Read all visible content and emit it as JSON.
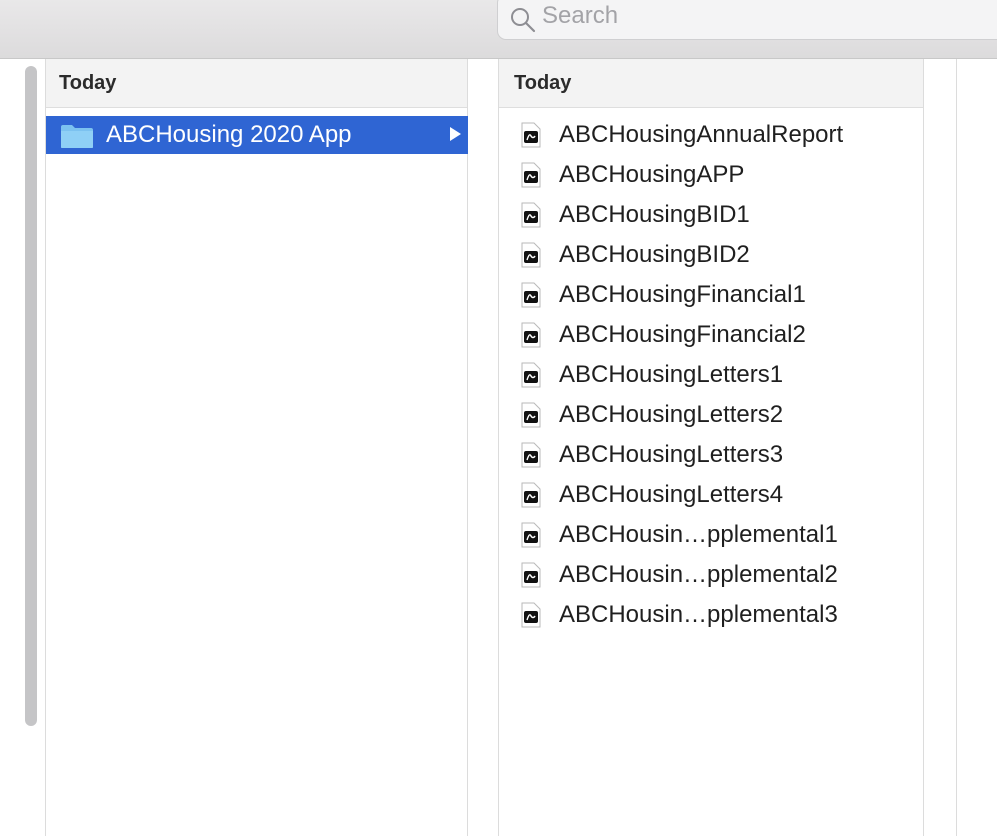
{
  "toolbar": {
    "search": {
      "placeholder": "Search",
      "value": ""
    }
  },
  "columns": [
    {
      "header": "Today",
      "items": [
        {
          "label": "ABCHousing 2020 App",
          "type": "folder",
          "selected": true,
          "icon": "folder-icon"
        }
      ]
    },
    {
      "header": "Today",
      "items": [
        {
          "label": "ABCHousingAnnualReport",
          "type": "pdf",
          "icon": "pdf-file-icon"
        },
        {
          "label": "ABCHousingAPP",
          "type": "pdf",
          "icon": "pdf-file-icon"
        },
        {
          "label": "ABCHousingBID1",
          "type": "pdf",
          "icon": "pdf-file-icon"
        },
        {
          "label": "ABCHousingBID2",
          "type": "pdf",
          "icon": "pdf-file-icon"
        },
        {
          "label": "ABCHousingFinancial1",
          "type": "pdf",
          "icon": "pdf-file-icon"
        },
        {
          "label": "ABCHousingFinancial2",
          "type": "pdf",
          "icon": "pdf-file-icon"
        },
        {
          "label": "ABCHousingLetters1",
          "type": "pdf",
          "icon": "pdf-file-icon"
        },
        {
          "label": "ABCHousingLetters2",
          "type": "pdf",
          "icon": "pdf-file-icon"
        },
        {
          "label": "ABCHousingLetters3",
          "type": "pdf",
          "icon": "pdf-file-icon"
        },
        {
          "label": "ABCHousingLetters4",
          "type": "pdf",
          "icon": "pdf-file-icon"
        },
        {
          "label": "ABCHousin…pplemental1",
          "type": "pdf",
          "icon": "pdf-file-icon"
        },
        {
          "label": "ABCHousin…pplemental2",
          "type": "pdf",
          "icon": "pdf-file-icon"
        },
        {
          "label": "ABCHousin…pplemental3",
          "type": "pdf",
          "icon": "pdf-file-icon"
        }
      ]
    }
  ],
  "colors": {
    "selection": "#2f65d3",
    "folder": "#7cc2f0",
    "toolbar": "#e1e0e1"
  }
}
